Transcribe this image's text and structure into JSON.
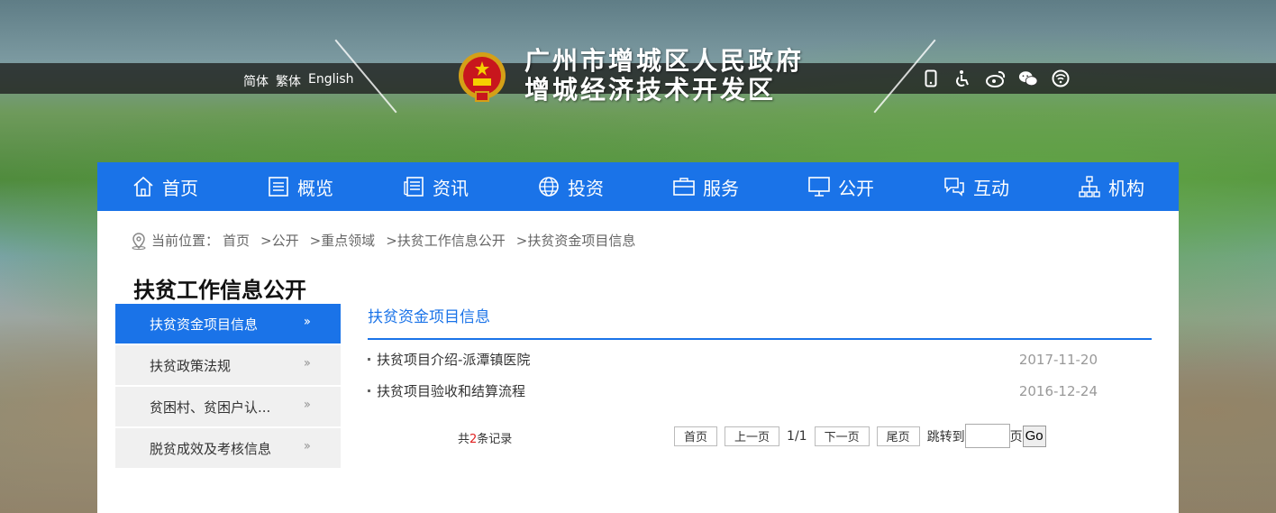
{
  "header": {
    "lang_links": [
      "简体",
      "繁体",
      "English"
    ],
    "title_line1": "广州市增城区人民政府",
    "title_line2": "增城经济技术开发区",
    "top_icons": [
      "mobile-icon",
      "accessibility-icon",
      "weibo-icon",
      "wechat-icon",
      "elderly-mode-icon"
    ]
  },
  "nav": [
    {
      "label": "首页",
      "icon": "home-icon"
    },
    {
      "label": "概览",
      "icon": "overview-icon"
    },
    {
      "label": "资讯",
      "icon": "news-icon"
    },
    {
      "label": "投资",
      "icon": "globe-icon"
    },
    {
      "label": "服务",
      "icon": "briefcase-icon"
    },
    {
      "label": "公开",
      "icon": "monitor-icon"
    },
    {
      "label": "互动",
      "icon": "chat-icon"
    },
    {
      "label": "机构",
      "icon": "org-chart-icon"
    }
  ],
  "breadcrumb": {
    "prefix": "当前位置：",
    "items": [
      "首页",
      ">公开",
      ">重点领域",
      ">扶贫工作信息公开",
      ">扶贫资金项目信息"
    ]
  },
  "sidebar": {
    "title": "扶贫工作信息公开",
    "items": [
      {
        "label": "扶贫资金项目信息",
        "active": true
      },
      {
        "label": "扶贫政策法规",
        "active": false
      },
      {
        "label": "贫困村、贫困户认...",
        "active": false
      },
      {
        "label": "脱贫成效及考核信息",
        "active": false
      }
    ]
  },
  "content": {
    "title": "扶贫资金项目信息",
    "rows": [
      {
        "title": "扶贫项目介绍-派潭镇医院",
        "date": "2017-11-20"
      },
      {
        "title": "扶贫项目验收和结算流程",
        "date": "2016-12-24"
      }
    ]
  },
  "pager": {
    "count_prefix": "共",
    "count_num": "2",
    "count_suffix": "条记录",
    "first": "首页",
    "prev": "上一页",
    "pageinfo": "1/1",
    "next": "下一页",
    "last": "尾页",
    "jump_label": "跳转到",
    "jump_value": "",
    "page_unit": "页",
    "go": "Go"
  },
  "colors": {
    "accent": "#1a73e8",
    "count_red": "#e02020"
  }
}
